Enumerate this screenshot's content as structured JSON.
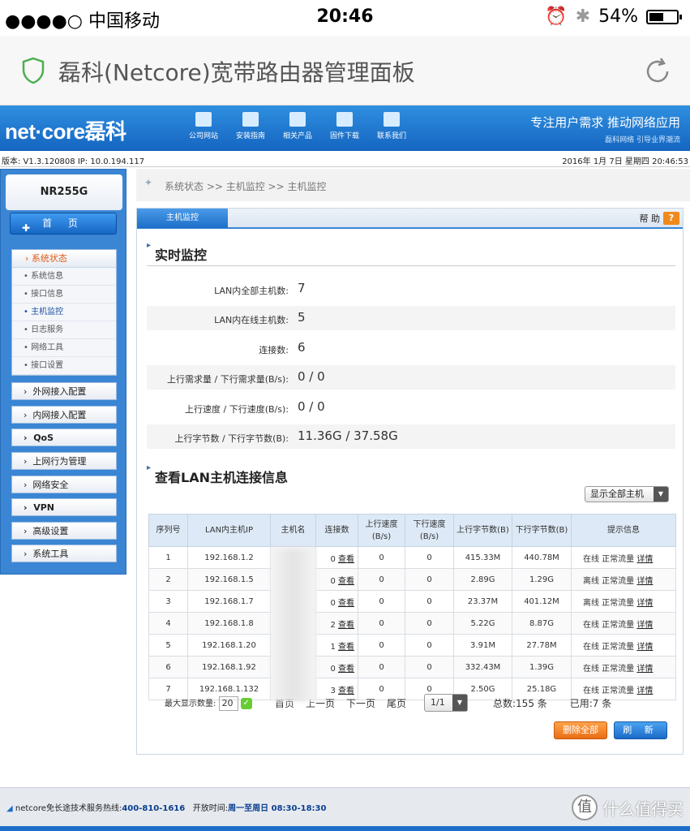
{
  "statusbar": {
    "carrier": "●●●●○ 中国移动",
    "time": "20:46",
    "battery": "54%",
    "battery_level": 0.54
  },
  "browser": {
    "title": "磊科(Netcore)宽带路由器管理面板"
  },
  "header": {
    "logo": "net·core磊科",
    "nav": [
      "公司网站",
      "安装指南",
      "相关产品",
      "固件下载",
      "联系我们"
    ],
    "slogan": "专注用户需求  推动网络应用",
    "slogan_sub": "磊科网络 引导业界潮流"
  },
  "infobar": {
    "version": "版本: V1.3.120808  IP: 10.0.194.117",
    "datetime": "2016年 1月 7日 星期四 20:46:53"
  },
  "sidebar": {
    "model": "NR255G",
    "home": "首 页",
    "system_status": "系统状态",
    "sub_items": [
      "系统信息",
      "接口信息",
      "主机监控",
      "日志服务",
      "网络工具",
      "接口设置"
    ],
    "menu": [
      "外网接入配置",
      "内网接入配置",
      "QoS",
      "上网行为管理",
      "网络安全",
      "VPN",
      "高级设置",
      "系统工具"
    ]
  },
  "breadcrumb": "系统状态  >>  主机监控  >>  主机监控",
  "panel": {
    "tab": "主机监控",
    "help": "帮 助",
    "section1": "实时监控",
    "stats": [
      {
        "label": "LAN内全部主机数:",
        "value": "7"
      },
      {
        "label": "LAN内在线主机数:",
        "value": "5"
      },
      {
        "label": "连接数:",
        "value": "6"
      },
      {
        "label": "上行需求量 / 下行需求量(B/s):",
        "value": "0   /   0"
      },
      {
        "label": "上行速度 / 下行速度(B/s):",
        "value": "0   /   0"
      },
      {
        "label": "上行字节数 / 下行字节数(B):",
        "value": "11.36G   /   37.58G"
      }
    ],
    "section2": "查看LAN主机连接信息",
    "dropdown": "显示全部主机",
    "columns": [
      "序列号",
      "LAN内主机IP",
      "主机名",
      "连接数",
      "上行速度(B/s)",
      "下行速度(B/s)",
      "上行字节数(B)",
      "下行字节数(B)",
      "提示信息"
    ],
    "rows": [
      {
        "no": "1",
        "ip": "192.168.1.2",
        "conn": "0",
        "up": "0",
        "down": "0",
        "upb": "415.33M",
        "downb": "440.78M",
        "tip": "在线 正常流量"
      },
      {
        "no": "2",
        "ip": "192.168.1.5",
        "conn": "0",
        "up": "0",
        "down": "0",
        "upb": "2.89G",
        "downb": "1.29G",
        "tip": "离线 正常流量"
      },
      {
        "no": "3",
        "ip": "192.168.1.7",
        "conn": "0",
        "up": "0",
        "down": "0",
        "upb": "23.37M",
        "downb": "401.12M",
        "tip": "离线 正常流量"
      },
      {
        "no": "4",
        "ip": "192.168.1.8",
        "conn": "2",
        "up": "0",
        "down": "0",
        "upb": "5.22G",
        "downb": "8.87G",
        "tip": "在线 正常流量"
      },
      {
        "no": "5",
        "ip": "192.168.1.20",
        "conn": "1",
        "up": "0",
        "down": "0",
        "upb": "3.91M",
        "downb": "27.78M",
        "tip": "在线 正常流量"
      },
      {
        "no": "6",
        "ip": "192.168.1.92",
        "conn": "0",
        "up": "0",
        "down": "0",
        "upb": "332.43M",
        "downb": "1.39G",
        "tip": "在线 正常流量"
      },
      {
        "no": "7",
        "ip": "192.168.1.132",
        "conn": "3",
        "up": "0",
        "down": "0",
        "upb": "2.50G",
        "downb": "25.18G",
        "tip": "在线 正常流量"
      }
    ],
    "view_label": "查看",
    "detail_label": "详情",
    "page_size_label": "最大显示数量:",
    "page_size": "20",
    "pager": [
      "首页",
      "上一页",
      "下一页",
      "尾页"
    ],
    "page_select": "1/1",
    "total": "总数:155 条",
    "used": "已用:7 条",
    "delete_all": "删除全部",
    "refresh": "刷 新"
  },
  "footer": {
    "hotline_prefix": "netcore免长途技术服务热线:",
    "hotline": "400-810-1616",
    "hours_prefix": "开放时间:",
    "hours": "周一至周日 08:30-18:30",
    "watermark": "什么值得买",
    "watermark_icon": "值"
  }
}
